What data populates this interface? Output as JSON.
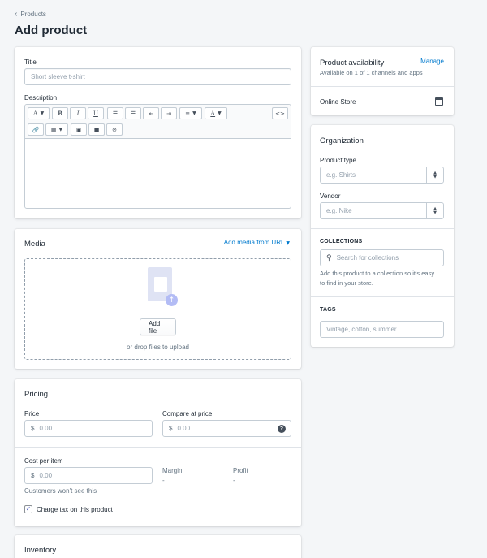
{
  "breadcrumb": {
    "label": "Products"
  },
  "page": {
    "title": "Add product"
  },
  "product": {
    "title_label": "Title",
    "title_placeholder": "Short sleeve t-shirt",
    "description_label": "Description"
  },
  "editor_toolbar": {
    "font_button": "A",
    "bold": "B",
    "italic": "I",
    "underline": "U",
    "color_button": "A",
    "html_button": "<>"
  },
  "media": {
    "heading": "Media",
    "add_url_link": "Add media from URL",
    "add_file_button": "Add file",
    "drop_hint": "or drop files to upload"
  },
  "pricing": {
    "heading": "Pricing",
    "price_label": "Price",
    "compare_label": "Compare at price",
    "currency": "$",
    "price_placeholder": "0.00",
    "compare_placeholder": "0.00",
    "cost_label": "Cost per item",
    "cost_placeholder": "0.00",
    "cost_help": "Customers won't see this",
    "margin_label": "Margin",
    "margin_value": "-",
    "profit_label": "Profit",
    "profit_value": "-",
    "charge_tax_label": "Charge tax on this product",
    "charge_tax_checked": true
  },
  "inventory": {
    "heading": "Inventory"
  },
  "availability": {
    "heading": "Product availability",
    "manage_link": "Manage",
    "subtext": "Available on 1 of 1 channels and apps",
    "channel": "Online Store"
  },
  "organization": {
    "heading": "Organization",
    "product_type_label": "Product type",
    "product_type_placeholder": "e.g. Shirts",
    "vendor_label": "Vendor",
    "vendor_placeholder": "e.g. Nike",
    "collections_heading": "COLLECTIONS",
    "collections_placeholder": "Search for collections",
    "collections_help_1": "Add this product to a collection so it's easy",
    "collections_help_2": "to find in your store.",
    "tags_heading": "TAGS",
    "tags_placeholder": "Vintage, cotton, summer"
  },
  "colors": {
    "link": "#007ace",
    "border": "#c4cdd5",
    "background": "#f4f6f8",
    "text": "#212b36",
    "muted": "#637381",
    "checkbox": "#5c6ac4"
  }
}
